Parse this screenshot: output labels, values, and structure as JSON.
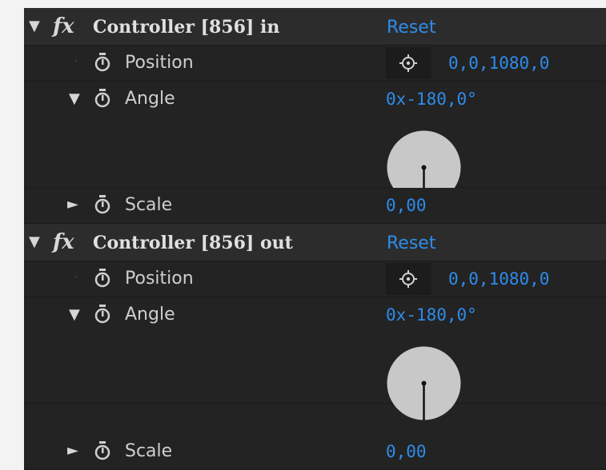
{
  "effects": [
    {
      "name": "Controller [856] in",
      "reset_label": "Reset",
      "position": {
        "label": "Position",
        "value": "0,0,1080,0"
      },
      "angle": {
        "label": "Angle",
        "value": "0x-180,0°",
        "dial_degrees": -180
      },
      "scale": {
        "label": "Scale",
        "value": "0,00"
      }
    },
    {
      "name": "Controller [856] out",
      "reset_label": "Reset",
      "position": {
        "label": "Position",
        "value": "0,0,1080,0"
      },
      "angle": {
        "label": "Angle",
        "value": "0x-180,0°",
        "dial_degrees": -180
      },
      "scale": {
        "label": "Scale",
        "value": "0,00"
      }
    }
  ],
  "colors": {
    "panel_bg": "#232323",
    "header_bg": "#2c2c2c",
    "value_blue": "#2d8ceb",
    "dial_fill": "#c8c8c8"
  },
  "icons": {
    "twirl_open": "▼",
    "twirl_closed": "►",
    "fx": "fx",
    "stopwatch": "stopwatch-icon",
    "crosshair": "crosshair-icon"
  }
}
